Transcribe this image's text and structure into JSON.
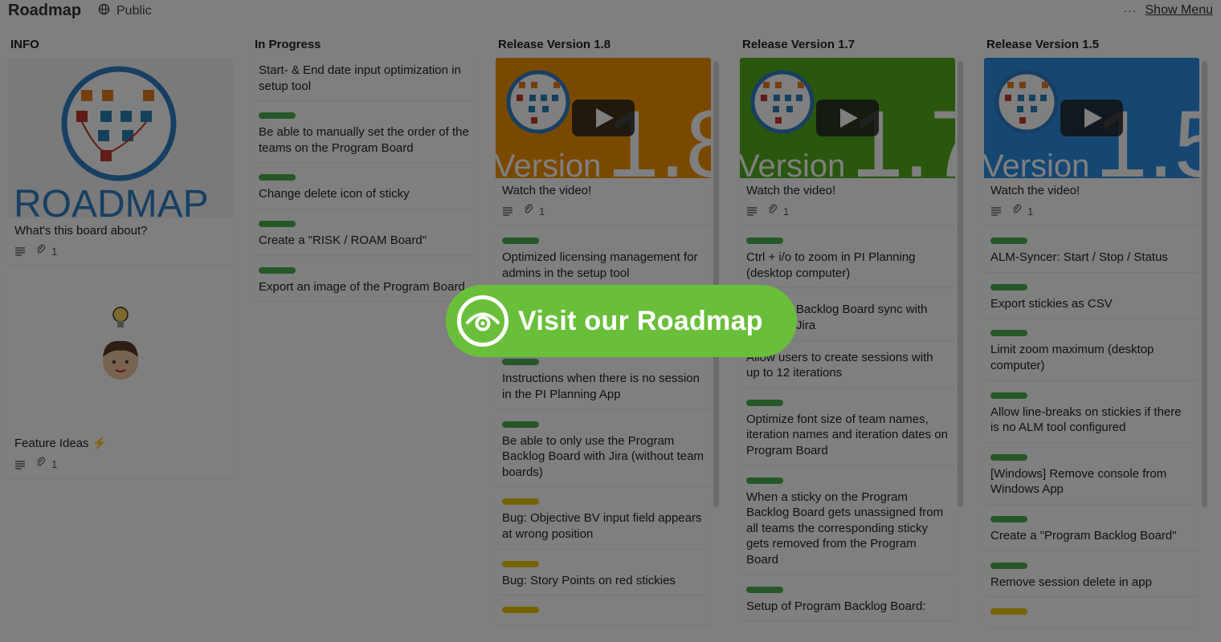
{
  "header": {
    "title": "Roadmap",
    "visibility": "Public",
    "menu_dots": "···",
    "show_menu": "Show Menu"
  },
  "lists": [
    {
      "title": "INFO",
      "cards": [
        {
          "cover": "roadmap-logo",
          "cover_text": "ROADMAP",
          "text": "What's this board about?",
          "attachments": "1"
        },
        {
          "cover": "feature-ideas-illustration",
          "text": "Feature Ideas ⚡",
          "attachments": "1"
        }
      ]
    },
    {
      "title": "In Progress",
      "cards": [
        {
          "text": "Start- & End date input optimization in setup tool"
        },
        {
          "label_color": "#4caf50",
          "text": "Be able to manually set the order of the teams on the Program Board"
        },
        {
          "label_color": "#4caf50",
          "text": "Change delete icon of sticky"
        },
        {
          "label_color": "#4caf50",
          "text": "Create a \"RISK / ROAM Board\""
        },
        {
          "label_color": "#4caf50",
          "text": "Export an image of the Program Board"
        }
      ]
    },
    {
      "title": "Release Version 1.8",
      "cover_color": "#f59300",
      "cover_word": "Version",
      "cover_number": "1.8",
      "cards": [
        {
          "text": "Watch the video!",
          "attachments": "1"
        },
        {
          "label_color": "#4caf50",
          "text": "Optimized licensing management for admins in the setup tool"
        },
        {
          "label_color": "#4caf50",
          "text": ""
        },
        {
          "label_color": "#4caf50",
          "text": "Instructions when there is no session in the PI Planning App"
        },
        {
          "label_color": "#4caf50",
          "text": "Be able to only use the Program Backlog Board with Jira (without team boards)"
        },
        {
          "label_color": "#e6c800",
          "text": "Bug: Objective BV input field appears at wrong position"
        },
        {
          "label_color": "#e6c800",
          "text": "Bug: Story Points on red stickies"
        },
        {
          "label_color": "#e6c800",
          "text": ""
        }
      ]
    },
    {
      "title": "Release Version 1.7",
      "cover_color": "#55ad1c",
      "cover_word": "Version",
      "cover_number": "1.7",
      "cards": [
        {
          "text": "Watch the video!",
          "attachments": "1"
        },
        {
          "label_color": "#4caf50",
          "text": "Ctrl + i/o to zoom in PI Planning (desktop computer)"
        },
        {
          "text": "Backlog Board sync with Jira"
        },
        {
          "text": "Allow users to create sessions with up to 12 iterations"
        },
        {
          "label_color": "#4caf50",
          "text": "Optimize font size of team names, iteration names and iteration dates on Program Board"
        },
        {
          "label_color": "#4caf50",
          "text": "When a sticky on the Program Backlog Board gets unassigned from all teams the corresponding sticky gets removed from the Program Board"
        },
        {
          "label_color": "#4caf50",
          "text": "Setup of Program Backlog Board:"
        }
      ]
    },
    {
      "title": "Release Version 1.5",
      "cover_color": "#2d8fe6",
      "cover_word": "Version",
      "cover_number": "1.5",
      "cards": [
        {
          "text": "Watch the video!",
          "attachments": "1"
        },
        {
          "label_color": "#4caf50",
          "text": "ALM-Syncer: Start / Stop / Status"
        },
        {
          "label_color": "#4caf50",
          "text": "Export stickies as CSV"
        },
        {
          "label_color": "#4caf50",
          "text": "Limit zoom maximum (desktop computer)"
        },
        {
          "label_color": "#4caf50",
          "text": "Allow line-breaks on stickies if there is no ALM tool configured"
        },
        {
          "label_color": "#4caf50",
          "text": "[Windows] Remove console from Windows App"
        },
        {
          "label_color": "#4caf50",
          "text": "Create a \"Program Backlog Board\""
        },
        {
          "label_color": "#4caf50",
          "text": "Remove session delete in app"
        },
        {
          "label_color": "#e6c800",
          "text": ""
        }
      ]
    }
  ],
  "cta": {
    "label": "Visit our Roadmap",
    "icon": "eye-icon",
    "color": "#6abf3a"
  }
}
